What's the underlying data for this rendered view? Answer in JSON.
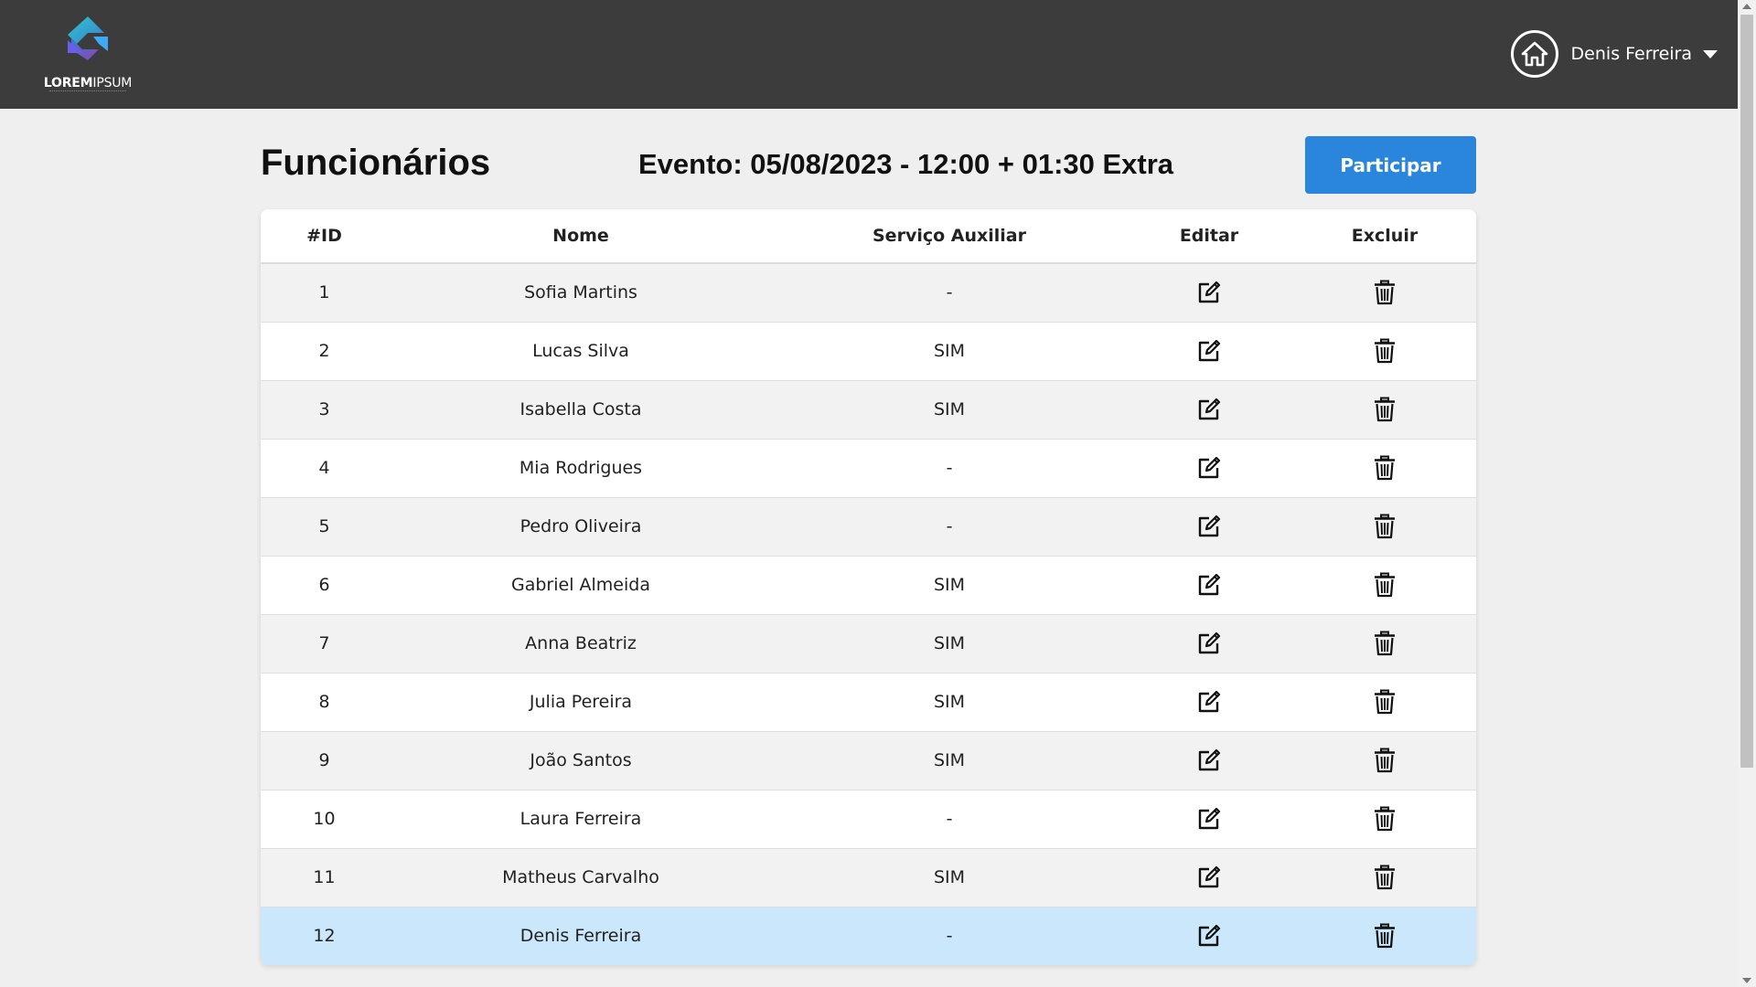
{
  "header": {
    "logo": {
      "text_bold": "LOREM",
      "text_light": "IPSUM"
    },
    "user": {
      "name": "Denis Ferreira"
    }
  },
  "page": {
    "title": "Funcionários",
    "event": "Evento: 05/08/2023 - 12:00 + 01:30 Extra",
    "participar_label": "Participar"
  },
  "table": {
    "columns": [
      "#ID",
      "Nome",
      "Serviço Auxiliar",
      "Editar",
      "Excluir"
    ],
    "rows": [
      {
        "id": "1",
        "nome": "Sofia Martins",
        "servico": "-"
      },
      {
        "id": "2",
        "nome": "Lucas Silva",
        "servico": "SIM"
      },
      {
        "id": "3",
        "nome": "Isabella Costa",
        "servico": "SIM"
      },
      {
        "id": "4",
        "nome": "Mia Rodrigues",
        "servico": "-"
      },
      {
        "id": "5",
        "nome": "Pedro Oliveira",
        "servico": "-"
      },
      {
        "id": "6",
        "nome": "Gabriel Almeida",
        "servico": "SIM"
      },
      {
        "id": "7",
        "nome": "Anna Beatriz",
        "servico": "SIM"
      },
      {
        "id": "8",
        "nome": "Julia Pereira",
        "servico": "SIM"
      },
      {
        "id": "9",
        "nome": "João Santos",
        "servico": "SIM"
      },
      {
        "id": "10",
        "nome": "Laura Ferreira",
        "servico": "-"
      },
      {
        "id": "11",
        "nome": "Matheus Carvalho",
        "servico": "SIM"
      },
      {
        "id": "12",
        "nome": "Denis Ferreira",
        "servico": "-"
      }
    ],
    "highlighted_row_id": "12"
  },
  "colors": {
    "topbar": "#3c3c3c",
    "accent": "#2a86dc",
    "highlight_row": "#cbe7fb",
    "page_background": "#efefef"
  },
  "icons": {
    "home": "home-icon",
    "dropdown": "caret-down-icon",
    "edit": "edit-icon",
    "delete": "trash-icon"
  }
}
